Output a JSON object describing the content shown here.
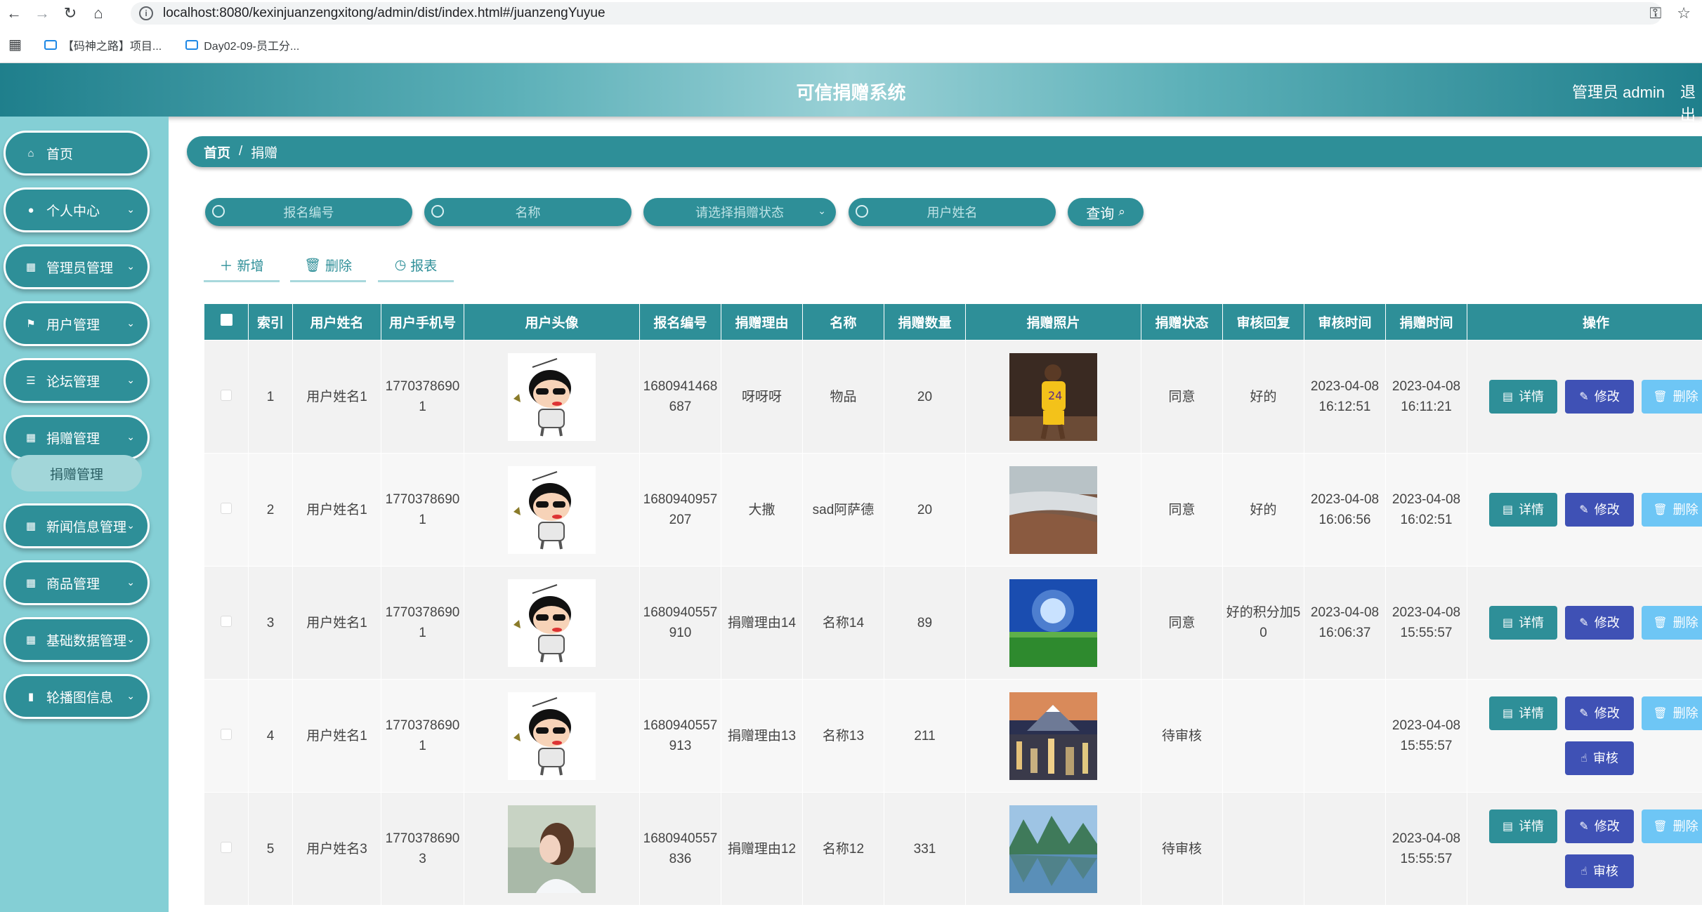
{
  "browser": {
    "url": "localhost:8080/kexinjuanzengxitong/admin/dist/index.html#/juanzengYuyue",
    "bookmarks": [
      "【码神之路】项目...",
      "Day02-09-员工分..."
    ]
  },
  "header": {
    "title": "可信捐赠系统",
    "user": "管理员 admin",
    "logout": "退出"
  },
  "sidebar": {
    "items": [
      {
        "label": "首页",
        "icon": "home-icon"
      },
      {
        "label": "个人中心",
        "icon": "user-icon"
      },
      {
        "label": "管理员管理",
        "icon": "grid-icon"
      },
      {
        "label": "用户管理",
        "icon": "flag-icon"
      },
      {
        "label": "论坛管理",
        "icon": "list-icon"
      },
      {
        "label": "捐赠管理",
        "icon": "grid-icon"
      },
      {
        "label": "新闻信息管理",
        "icon": "grid-icon"
      },
      {
        "label": "商品管理",
        "icon": "grid-icon"
      },
      {
        "label": "基础数据管理",
        "icon": "grid-icon"
      },
      {
        "label": "轮播图信息",
        "icon": "bar-icon"
      }
    ],
    "submenu": "捐赠管理"
  },
  "breadcrumb": {
    "home": "首页",
    "sep": "/",
    "current": "捐赠"
  },
  "search": {
    "baoming_placeholder": "报名编号",
    "name_placeholder": "名称",
    "status_placeholder": "请选择捐赠状态",
    "username_placeholder": "用户姓名",
    "query_label": "查询"
  },
  "actions": {
    "add": "新增",
    "delete": "删除",
    "report": "报表"
  },
  "table": {
    "headers": [
      "索引",
      "用户姓名",
      "用户手机号",
      "用户头像",
      "报名编号",
      "捐赠理由",
      "名称",
      "捐赠数量",
      "捐赠照片",
      "捐赠状态",
      "审核回复",
      "审核时间",
      "捐赠时间",
      "操作"
    ],
    "op_labels": {
      "detail": "详情",
      "edit": "修改",
      "delete": "删除",
      "audit": "审核"
    },
    "rows": [
      {
        "index": "1",
        "username": "用户姓名1",
        "phone": "17703786901",
        "avatar": "cartoon-avatar",
        "code": "1680941468687",
        "reason": "呀呀呀",
        "name": "物品",
        "qty": "20",
        "photo": "basketball-player-photo",
        "status": "同意",
        "reply": "好的",
        "audit_time": "2023-04-08 16:12:51",
        "time": "2023-04-08 16:11:21",
        "audit_btn": false
      },
      {
        "index": "2",
        "username": "用户姓名1",
        "phone": "17703786901",
        "avatar": "cartoon-avatar",
        "code": "1680940957207",
        "reason": "大撒",
        "name": "sad阿萨德",
        "qty": "20",
        "photo": "coast-photo",
        "status": "同意",
        "reply": "好的",
        "audit_time": "2023-04-08 16:06:56",
        "time": "2023-04-08 16:02:51",
        "audit_btn": false
      },
      {
        "index": "3",
        "username": "用户姓名1",
        "phone": "17703786901",
        "avatar": "cartoon-avatar",
        "code": "1680940557910",
        "reason": "捐赠理由14",
        "name": "名称14",
        "qty": "89",
        "photo": "meadow-sky-photo",
        "status": "同意",
        "reply": "好的积分加50",
        "audit_time": "2023-04-08 16:06:37",
        "time": "2023-04-08 15:55:57",
        "audit_btn": false
      },
      {
        "index": "4",
        "username": "用户姓名1",
        "phone": "17703786901",
        "avatar": "cartoon-avatar",
        "code": "1680940557913",
        "reason": "捐赠理由13",
        "name": "名称13",
        "qty": "211",
        "photo": "city-mountain-photo",
        "status": "待审核",
        "reply": "",
        "audit_time": "",
        "time": "2023-04-08 15:55:57",
        "audit_btn": true
      },
      {
        "index": "5",
        "username": "用户姓名3",
        "phone": "17703786903",
        "avatar": "girl-profile-avatar",
        "code": "1680940557836",
        "reason": "捐赠理由12",
        "name": "名称12",
        "qty": "331",
        "photo": "lake-mountain-photo",
        "status": "待审核",
        "reply": "",
        "audit_time": "",
        "time": "2023-04-08 15:55:57",
        "audit_btn": true
      }
    ]
  }
}
